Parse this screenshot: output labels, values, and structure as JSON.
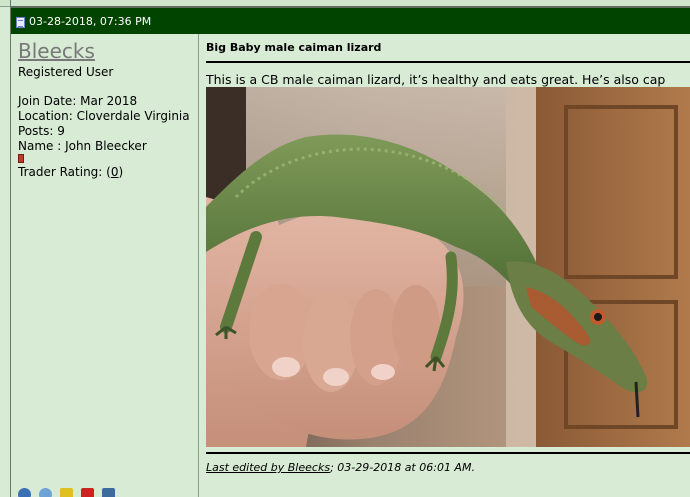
{
  "post": {
    "date": "03-28-2018, 07:36 PM",
    "icon": "post-icon"
  },
  "user": {
    "name": "Bleecks",
    "title": "Registered User",
    "join_date": "Join Date: Mar 2018",
    "location": "Location: Cloverdale Virginia",
    "posts": "Posts: 9",
    "real_name": "Name : John Bleecker",
    "trader_label": "Trader Rating: (",
    "trader_value": "0",
    "trader_close": ")"
  },
  "message": {
    "title": "Big Baby male caiman lizard",
    "text": "This is a CB male caiman lizard, it’s healthy and eats great. He’s also cap",
    "image_subject": "caiman-lizard-on-hand-photo",
    "edit_prefix": "Last edited by Bleecks",
    "edit_suffix": "; 03-29-2018 at 06:01 AM."
  },
  "colors": {
    "header_bg": "#004400",
    "panel_bg": "#d7ebd5",
    "username": "#787878"
  }
}
